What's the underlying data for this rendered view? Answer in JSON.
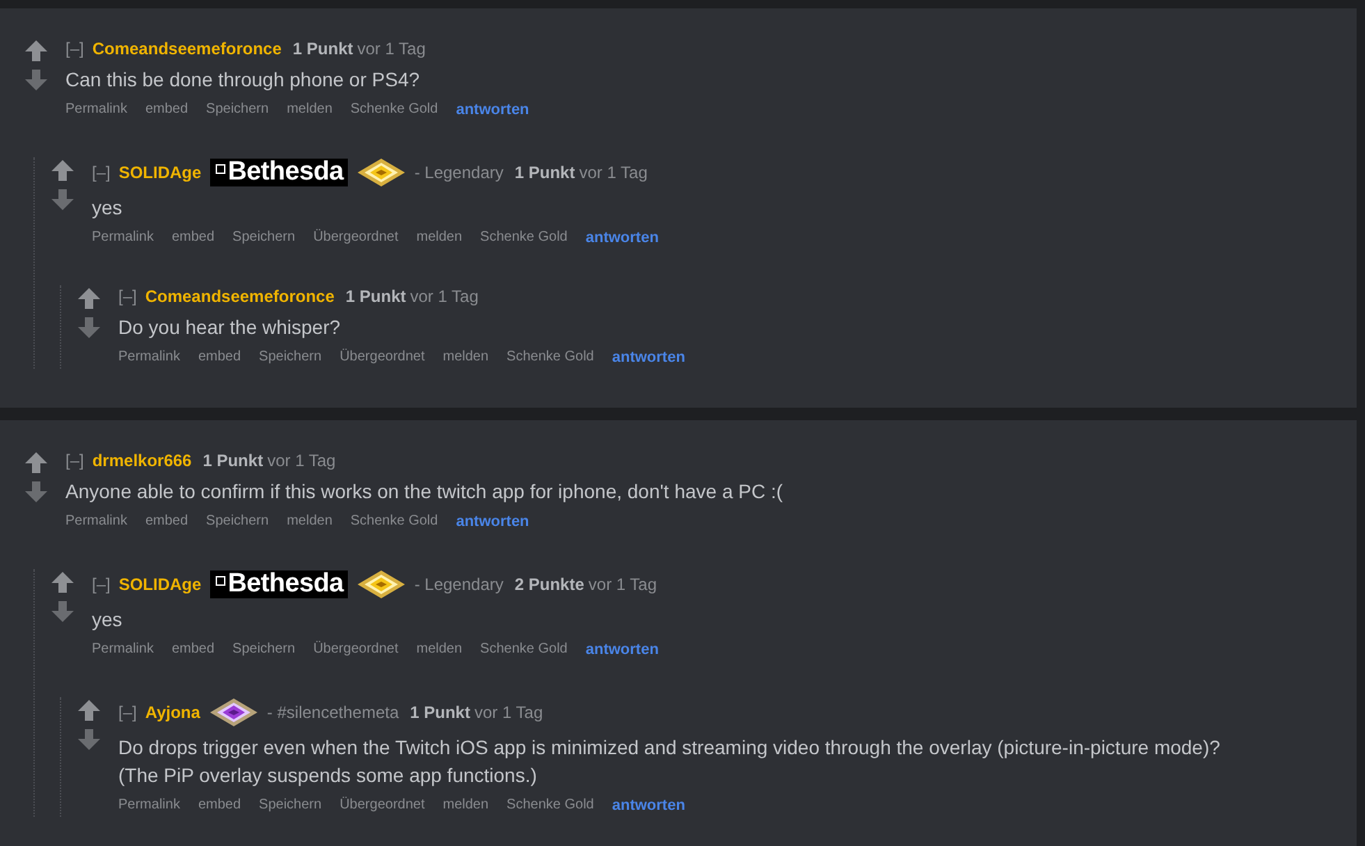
{
  "threads": [
    {
      "collapse": "[–]",
      "author": "Comeandseemeforonce",
      "score": "1 Punkt",
      "time": "vor 1 Tag",
      "body": "Can this be done through phone or PS4?",
      "actions": [
        {
          "label": "Permalink",
          "kind": "link"
        },
        {
          "label": "embed",
          "kind": "link"
        },
        {
          "label": "Speichern",
          "kind": "link"
        },
        {
          "label": "melden",
          "kind": "link"
        },
        {
          "label": "Schenke Gold",
          "kind": "link"
        },
        {
          "label": "antworten",
          "kind": "reply"
        }
      ],
      "children": [
        {
          "collapse": "[–]",
          "author": "SOLIDAge",
          "logo": "Bethesda",
          "badge": {
            "kind": "gold"
          },
          "flair": "- Legendary",
          "score": "1 Punkt",
          "time": "vor 1 Tag",
          "body": "yes",
          "actions": [
            {
              "label": "Permalink",
              "kind": "link"
            },
            {
              "label": "embed",
              "kind": "link"
            },
            {
              "label": "Speichern",
              "kind": "link"
            },
            {
              "label": "Übergeordnet",
              "kind": "link"
            },
            {
              "label": "melden",
              "kind": "link"
            },
            {
              "label": "Schenke Gold",
              "kind": "link"
            },
            {
              "label": "antworten",
              "kind": "reply"
            }
          ],
          "children": [
            {
              "collapse": "[–]",
              "author": "Comeandseemeforonce",
              "score": "1 Punkt",
              "time": "vor 1 Tag",
              "body": "Do you hear the whisper?",
              "actions": [
                {
                  "label": "Permalink",
                  "kind": "link"
                },
                {
                  "label": "embed",
                  "kind": "link"
                },
                {
                  "label": "Speichern",
                  "kind": "link"
                },
                {
                  "label": "Übergeordnet",
                  "kind": "link"
                },
                {
                  "label": "melden",
                  "kind": "link"
                },
                {
                  "label": "Schenke Gold",
                  "kind": "link"
                },
                {
                  "label": "antworten",
                  "kind": "reply"
                }
              ]
            }
          ]
        }
      ]
    },
    {
      "collapse": "[–]",
      "author": "drmelkor666",
      "score": "1 Punkt",
      "time": "vor 1 Tag",
      "body": "Anyone able to confirm if this works on the twitch app for iphone, don't have a PC :(",
      "actions": [
        {
          "label": "Permalink",
          "kind": "link"
        },
        {
          "label": "embed",
          "kind": "link"
        },
        {
          "label": "Speichern",
          "kind": "link"
        },
        {
          "label": "melden",
          "kind": "link"
        },
        {
          "label": "Schenke Gold",
          "kind": "link"
        },
        {
          "label": "antworten",
          "kind": "reply"
        }
      ],
      "children": [
        {
          "collapse": "[–]",
          "author": "SOLIDAge",
          "logo": "Bethesda",
          "badge": {
            "kind": "gold"
          },
          "flair": "- Legendary",
          "score": "2 Punkte",
          "time": "vor 1 Tag",
          "body": "yes",
          "actions": [
            {
              "label": "Permalink",
              "kind": "link"
            },
            {
              "label": "embed",
              "kind": "link"
            },
            {
              "label": "Speichern",
              "kind": "link"
            },
            {
              "label": "Übergeordnet",
              "kind": "link"
            },
            {
              "label": "melden",
              "kind": "link"
            },
            {
              "label": "Schenke Gold",
              "kind": "link"
            },
            {
              "label": "antworten",
              "kind": "reply"
            }
          ],
          "children": [
            {
              "collapse": "[–]",
              "author": "Ayjona",
              "badge": {
                "kind": "purple"
              },
              "flair": "- #silencethemeta",
              "score": "1 Punkt",
              "time": "vor 1 Tag",
              "body": "Do drops trigger even when the Twitch iOS app is minimized and streaming video through the overlay (picture-in-picture mode)? (The PiP overlay suspends some app functions.)",
              "actions": [
                {
                  "label": "Permalink",
                  "kind": "link"
                },
                {
                  "label": "embed",
                  "kind": "link"
                },
                {
                  "label": "Speichern",
                  "kind": "link"
                },
                {
                  "label": "Übergeordnet",
                  "kind": "link"
                },
                {
                  "label": "melden",
                  "kind": "link"
                },
                {
                  "label": "Schenke Gold",
                  "kind": "link"
                },
                {
                  "label": "antworten",
                  "kind": "reply"
                }
              ]
            }
          ]
        }
      ]
    }
  ]
}
